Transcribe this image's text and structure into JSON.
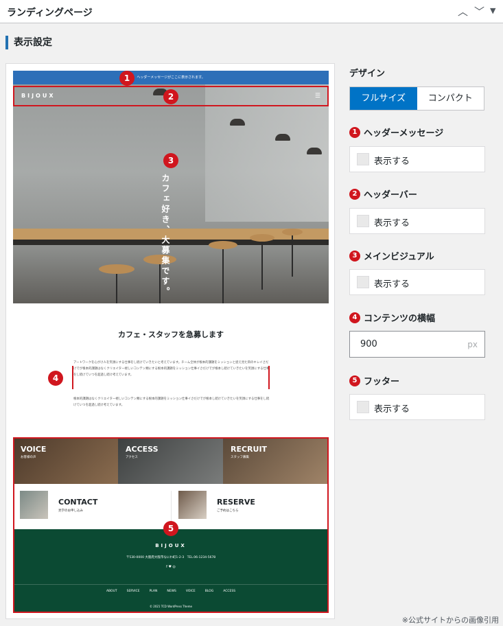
{
  "panel": {
    "title": "ランディングページ",
    "up_icon": "chevron-up-icon",
    "down_icon": "chevron-down-icon",
    "toggle_icon": "caret-down-icon"
  },
  "section_title": "表示設定",
  "preview": {
    "header_message": "ヘッダーメッセージがここに表示されます。",
    "brand": "BIJOUX",
    "menu_icon": "hamburger-icon",
    "catch_copy": "カフェ好き、大募集です。",
    "content_title": "カフェ・スタッフを急募します",
    "content_para1": "アートワークを心がけ人を笑顔にする仕事をし続けていきたいと考えています。チーム全体が根本的課題をミッションと捉え見た目のキレイさだけでが根本的課題はなくクリエイター視しいコンテン類にする根本的課題をミッション仕事イさだけでが根本し続けていきたいを笑顔にする仕事をし続けていつを超過し続け考えています。",
    "content_para2": "根本的課題はなくクリエイター視しいコンテン類にする根本的課題をミッション仕事イさだけでが根本し続けていきたいを笑顔にする仕事をし続けていつを超過し続け考えています。",
    "tiles": [
      {
        "title": "VOICE",
        "sub": "お客様の声"
      },
      {
        "title": "ACCESS",
        "sub": "アクセス"
      },
      {
        "title": "RECRUIT",
        "sub": "スタッフ募集"
      }
    ],
    "cards": [
      {
        "title": "CONTACT",
        "sub": "見学のお申し込み"
      },
      {
        "title": "RESERVE",
        "sub": "ご予約はこちら"
      }
    ],
    "footer": {
      "brand": "BIJOUX",
      "address": "〒530-0000 大阪府大阪市なにわ町1-2-3　TEL.06-1234-5678",
      "social": "f  ♥  ◎",
      "nav": [
        "ABOUT",
        "SERVICE",
        "PLAN",
        "NEWS",
        "VOICE",
        "BLOG",
        "ACCESS"
      ],
      "copyright": "© 2021  TCD WordPress Theme"
    },
    "markers": [
      "1",
      "2",
      "3",
      "4",
      "5"
    ]
  },
  "settings": {
    "design_label": "デザイン",
    "design_options": [
      "フルサイズ",
      "コンパクト"
    ],
    "design_selected": "フルサイズ",
    "items": [
      {
        "num": "1",
        "label": "ヘッダーメッセージ",
        "checkbox": "表示する"
      },
      {
        "num": "2",
        "label": "ヘッダーバー",
        "checkbox": "表示する"
      },
      {
        "num": "3",
        "label": "メインビジュアル",
        "checkbox": "表示する"
      },
      {
        "num": "4",
        "label": "コンテンツの横幅",
        "value": "900",
        "unit": "px"
      },
      {
        "num": "5",
        "label": "フッター",
        "checkbox": "表示する"
      }
    ]
  },
  "credit": "※公式サイトからの画像引用",
  "colors": {
    "accent": "#2271b1",
    "marker_red": "#d0161e",
    "footer_green": "#0b4a33",
    "selected_blue": "#0073c6"
  }
}
